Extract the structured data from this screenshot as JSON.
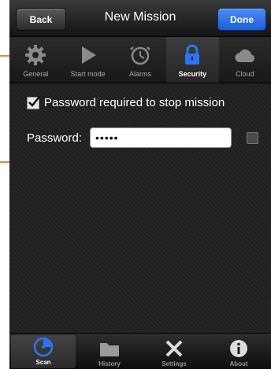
{
  "navbar": {
    "back_label": "Back",
    "title": "New Mission",
    "done_label": "Done"
  },
  "segments": [
    {
      "label": "General",
      "icon": "gear-icon",
      "active": false
    },
    {
      "label": "Start mode",
      "icon": "play-icon",
      "active": false
    },
    {
      "label": "Alarms",
      "icon": "alarm-clock-icon",
      "active": false
    },
    {
      "label": "Security",
      "icon": "lock-icon",
      "active": true
    },
    {
      "label": "Cloud",
      "icon": "cloud-icon",
      "active": false
    }
  ],
  "security": {
    "password_required_label": "Password required to stop mission",
    "password_required_checked": true,
    "password_label": "Password:",
    "password_value": "•••••"
  },
  "tabs": [
    {
      "label": "Scan",
      "icon": "scan-icon",
      "active": true
    },
    {
      "label": "History",
      "icon": "folder-icon",
      "active": false
    },
    {
      "label": "Settings",
      "icon": "tools-icon",
      "active": false
    },
    {
      "label": "About",
      "icon": "info-icon",
      "active": false
    }
  ],
  "colors": {
    "callout": "#e8863a",
    "accent_blue": "#2f74ef",
    "background": "#1e1e1e"
  }
}
